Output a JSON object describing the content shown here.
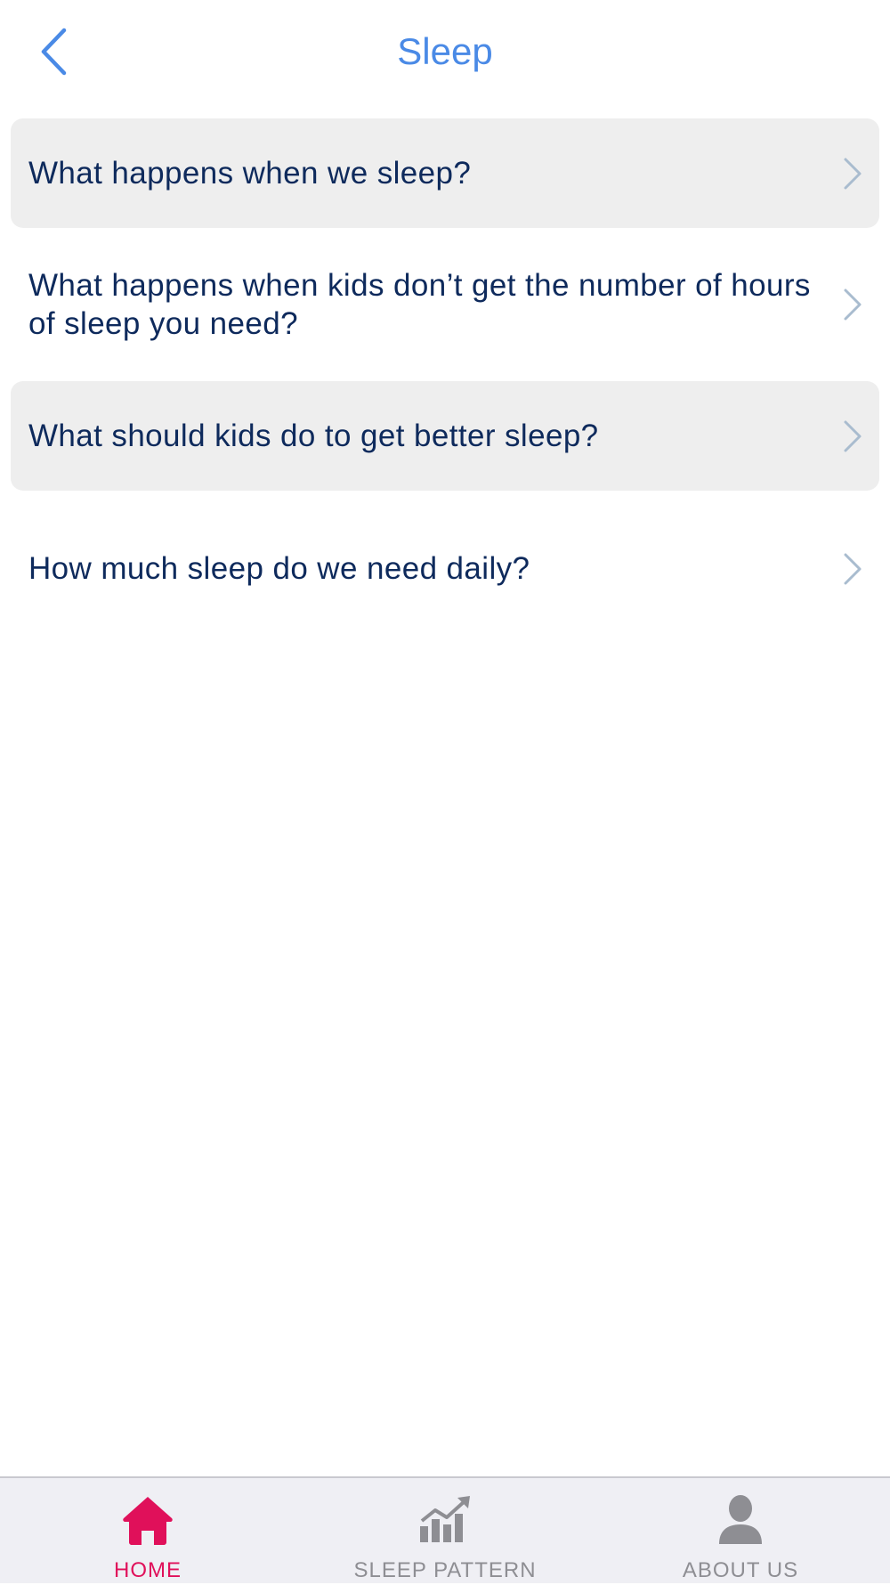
{
  "header": {
    "title": "Sleep",
    "back_icon": "chevron-left-icon"
  },
  "colors": {
    "accent": "#4a8ae6",
    "row_text": "#0e2a5c",
    "row_shaded_bg": "#eeeeee",
    "chevron": "#a9bccf",
    "tab_active": "#e0105a",
    "tab_inactive": "#8e8e93",
    "tabbar_bg": "#efeff4"
  },
  "list": {
    "items": [
      {
        "label": "What happens when we sleep?",
        "icon": "chevron-right-icon"
      },
      {
        "label": "What happens when kids don’t get the number of hours of sleep you need?",
        "icon": "chevron-right-icon"
      },
      {
        "label": "What should kids do to get better sleep?",
        "icon": "chevron-right-icon"
      },
      {
        "label": "How much sleep do we need daily?",
        "icon": "chevron-right-icon"
      }
    ]
  },
  "tabbar": {
    "tabs": [
      {
        "label": "HOME",
        "icon": "home-icon",
        "active": true
      },
      {
        "label": "SLEEP PATTERN",
        "icon": "chart-icon",
        "active": false
      },
      {
        "label": "ABOUT US",
        "icon": "person-icon",
        "active": false
      }
    ]
  }
}
